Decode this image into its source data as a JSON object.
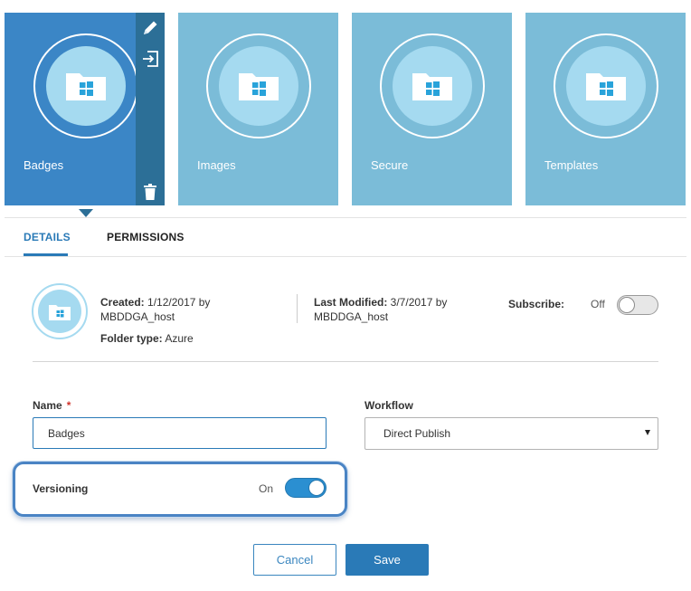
{
  "folders": [
    {
      "label": "Badges",
      "selected": true
    },
    {
      "label": "Images",
      "selected": false
    },
    {
      "label": "Secure",
      "selected": false
    },
    {
      "label": "Templates",
      "selected": false
    }
  ],
  "folder_actions": {
    "edit_icon": "pencil-icon",
    "move_icon": "move-to-icon",
    "delete_icon": "trash-icon"
  },
  "tabs": {
    "details": "DETAILS",
    "permissions": "PERMISSIONS",
    "active": "details"
  },
  "info": {
    "created_label": "Created:",
    "created_value": "1/12/2017 by MBDDGA_host",
    "folder_type_label": "Folder type:",
    "folder_type_value": "Azure",
    "modified_label": "Last Modified:",
    "modified_value": "3/7/2017 by MBDDGA_host",
    "subscribe_label": "Subscribe:",
    "subscribe_state": "Off"
  },
  "form": {
    "name_label": "Name",
    "required_mark": "*",
    "name_value": "Badges",
    "workflow_label": "Workflow",
    "workflow_value": "Direct Publish",
    "versioning_label": "Versioning",
    "versioning_state": "On"
  },
  "buttons": {
    "cancel": "Cancel",
    "save": "Save"
  },
  "colors": {
    "selected_tile": "#3b86c6",
    "tile": "#7bbcd8",
    "accent": "#2a7ab7",
    "toggle_on": "#2b8fd1",
    "highlight": "#4a84c4"
  }
}
